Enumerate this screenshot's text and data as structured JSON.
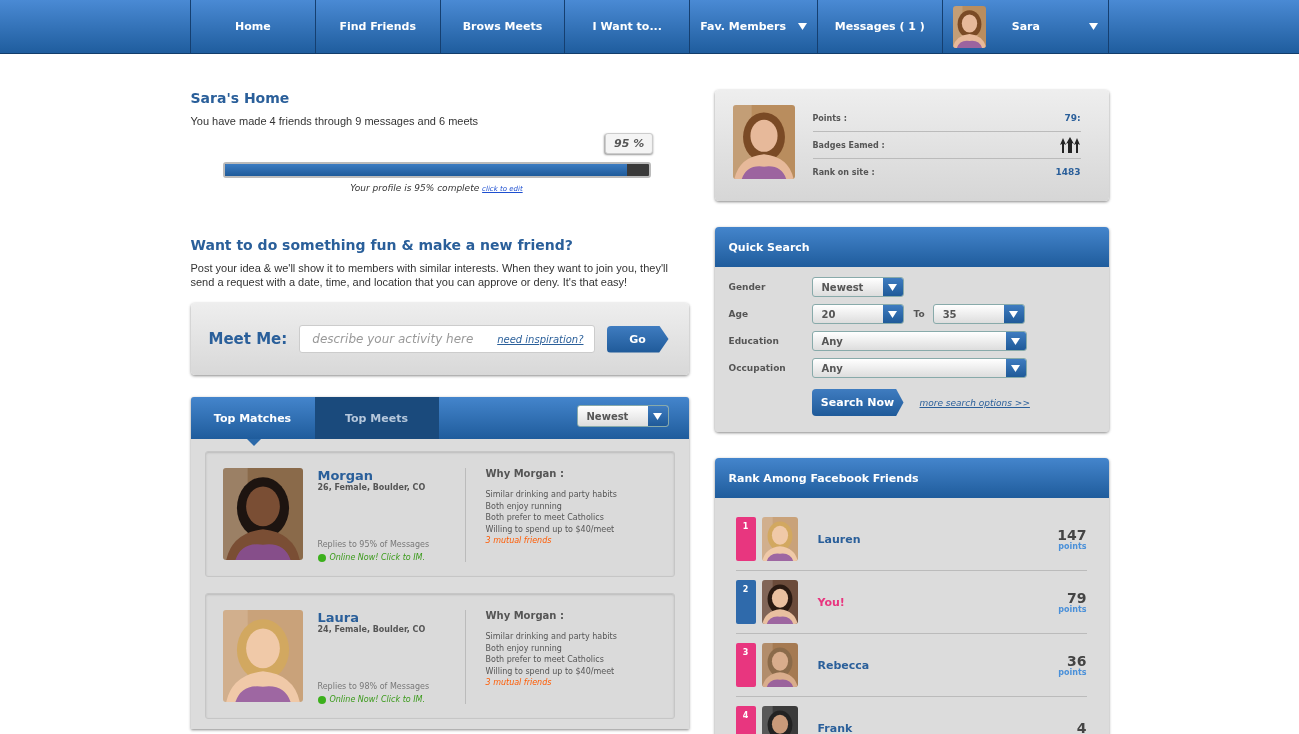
{
  "nav": [
    {
      "label": "Home",
      "has_menu": false,
      "avatar": false
    },
    {
      "label": "Find Friends",
      "has_menu": false,
      "avatar": false
    },
    {
      "label": "Brows Meets",
      "has_menu": false,
      "avatar": false
    },
    {
      "label": "I Want to...",
      "has_menu": false,
      "avatar": false
    },
    {
      "label": "Fav. Members",
      "has_menu": true,
      "avatar": false
    },
    {
      "label": "Messages ( 1 )",
      "has_menu": false,
      "avatar": false
    },
    {
      "label": "Sara",
      "has_menu": true,
      "avatar": true
    }
  ],
  "home": {
    "title": "Sara's Home",
    "summary": "You have made 4 friends through 9 messages and 6 meets",
    "progress": {
      "level": 0.95,
      "bubble": "95 %",
      "caption": "Your profile is 95% complete",
      "link": "click to edit"
    }
  },
  "meet": {
    "title": "Want to do something fun & make a new friend?",
    "text": "Post your idea & we'll show it to members with similar interests.  When they want to join you, they'll send a request with a date, time, and location that you can approve or deny.  It's that easy!",
    "label": "Meet Me:",
    "placeholder": "describe your activity here",
    "link": "need inspiration?",
    "button": "Go"
  },
  "matches": {
    "tabs": [
      {
        "label": "Top Matches",
        "selected": true
      },
      {
        "label": "Top Meets",
        "selected": false
      }
    ],
    "sort": "Newest",
    "cards": [
      {
        "name": "Morgan",
        "details": "26, Female, Boulder, CO",
        "replies": "Replies to 95% of Messages",
        "online": true,
        "status": "Online Now! Click to IM.",
        "why": "Why Morgan :",
        "reasons": [
          "Similar drinking and party habits",
          "Both enjoy running",
          "Both prefer to meet Catholics",
          "Willing to spend up to $40/meet"
        ],
        "mutual": "3 mutual friends"
      },
      {
        "name": "Laura",
        "details": "24, Female, Boulder, CO",
        "replies": "Replies to 98% of Messages",
        "online": true,
        "status": "Online Now! Click to IM.",
        "why": "Why Morgan :",
        "reasons": [
          "Similar drinking and party habits",
          "Both enjoy running",
          "Both prefer to meet Catholics",
          "Willing to spend up to $40/meet"
        ],
        "mutual": "3 mutual friends"
      }
    ]
  },
  "profile_stats": [
    {
      "label": "Points :",
      "kind": "text",
      "value": "79:"
    },
    {
      "label": "Badges Eamed :",
      "kind": "badges"
    },
    {
      "label": "Rank on site :",
      "kind": "text",
      "value": "1483"
    }
  ],
  "quick_search": {
    "title": "Quick Search",
    "rows": [
      {
        "label": "Gender",
        "selects": [
          "Newest"
        ]
      },
      {
        "label": "Age",
        "selects": [
          "20",
          "35"
        ],
        "between": "To"
      },
      {
        "label": "Education",
        "selects": [
          "Any"
        ]
      },
      {
        "label": "Occupation",
        "selects": [
          "Any"
        ]
      }
    ],
    "button": "Search Now",
    "link": "more search options >>"
  },
  "rank": {
    "title": "Rank Among Facebook Friends",
    "rows": [
      {
        "rank": "1",
        "color": "#e8367f",
        "name": "Lauren",
        "kind": "friend",
        "points": "147",
        "unit": "points"
      },
      {
        "rank": "2",
        "color": "#2f6aab",
        "name": "You!",
        "kind": "you",
        "points": "79",
        "unit": "points"
      },
      {
        "rank": "3",
        "color": "#e8367f",
        "name": "Rebecca",
        "kind": "friend",
        "points": "36",
        "unit": "points"
      },
      {
        "rank": "4",
        "color": "#e8367f",
        "name": "Frank",
        "kind": "friend",
        "points": "4"
      }
    ]
  }
}
